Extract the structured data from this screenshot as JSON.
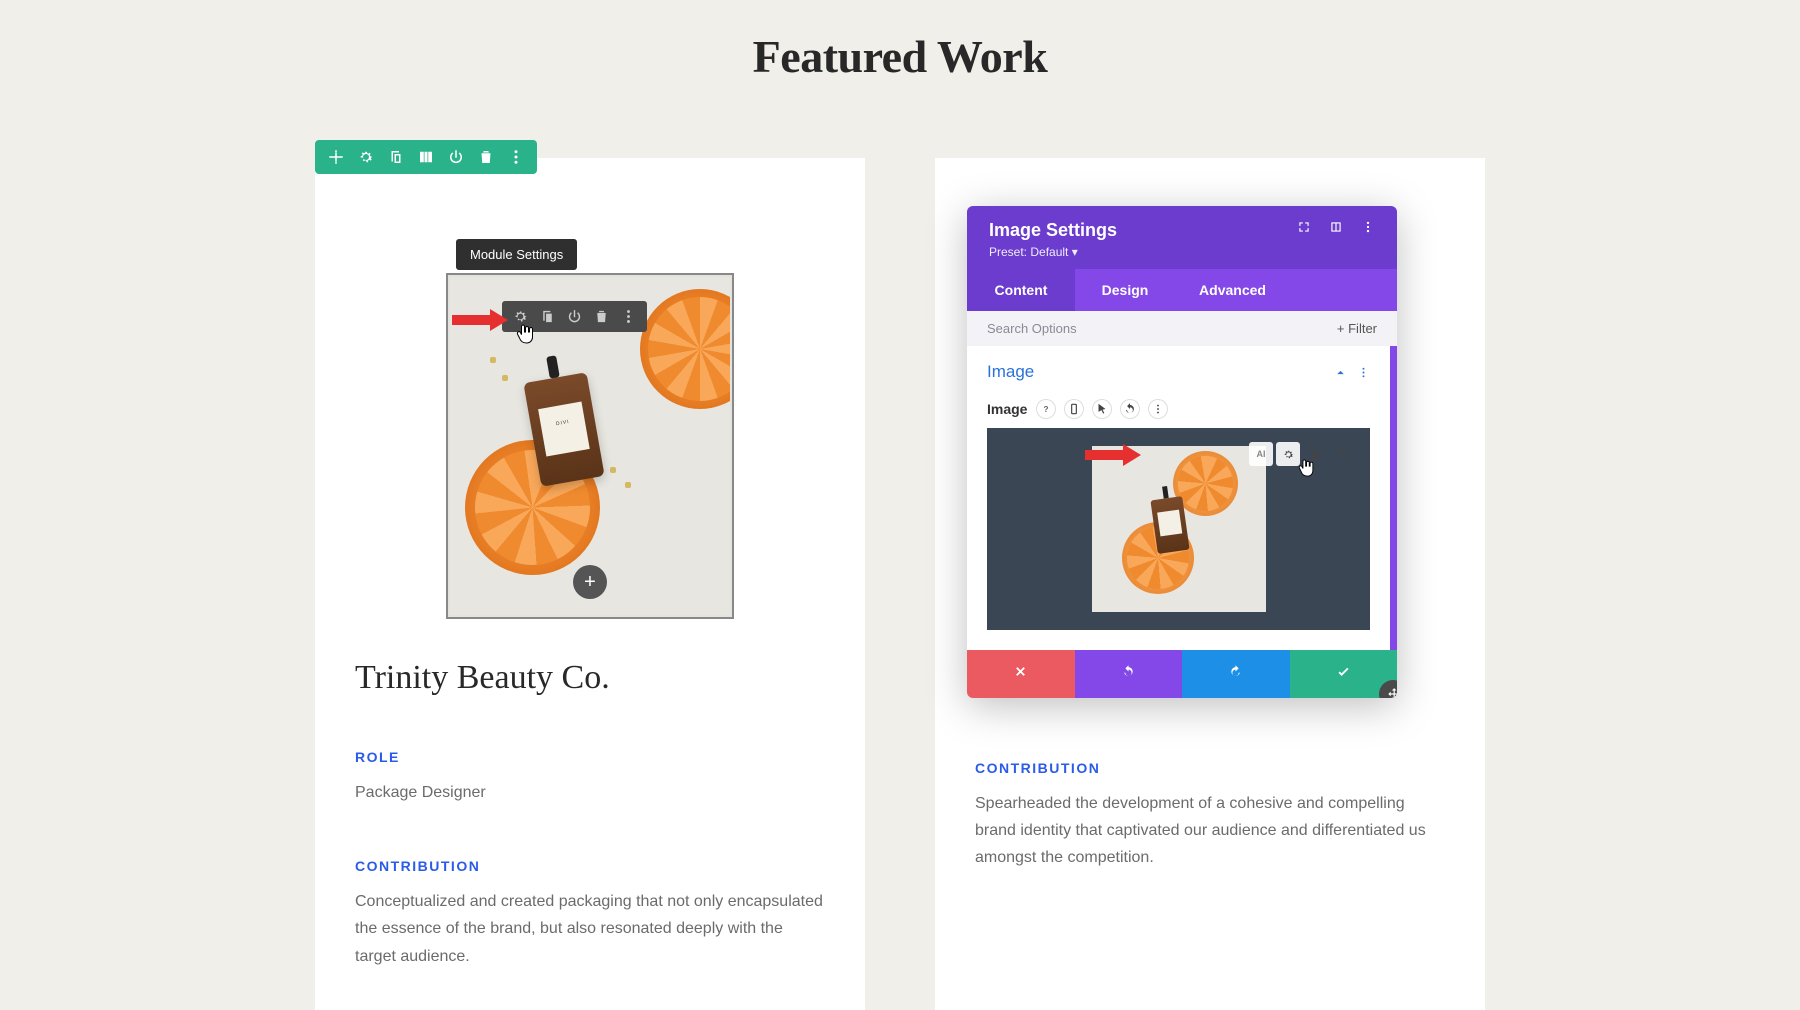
{
  "heading": "Featured Work",
  "module_tooltip": "Module Settings",
  "card1": {
    "title": "Trinity Beauty Co.",
    "role_label": "ROLE",
    "role_value": "Package Designer",
    "contrib_label": "CONTRIBUTION",
    "contrib_value": "Conceptualized and created packaging that not only encapsulated the essence of the brand, but also resonated deeply with the target audience.",
    "bottle_brand": "DIVI",
    "add_label": "+"
  },
  "card2": {
    "contrib_label": "CONTRIBUTION",
    "contrib_value": "Spearheaded the development of a cohesive and compelling brand identity that captivated our audience and differentiated us amongst the competition."
  },
  "panel": {
    "title": "Image Settings",
    "preset": "Preset: Default",
    "tabs": {
      "content": "Content",
      "design": "Design",
      "advanced": "Advanced"
    },
    "search_placeholder": "Search Options",
    "filter_label": "Filter",
    "acc_title": "Image",
    "field_label": "Image",
    "ai_badge": "AI"
  }
}
